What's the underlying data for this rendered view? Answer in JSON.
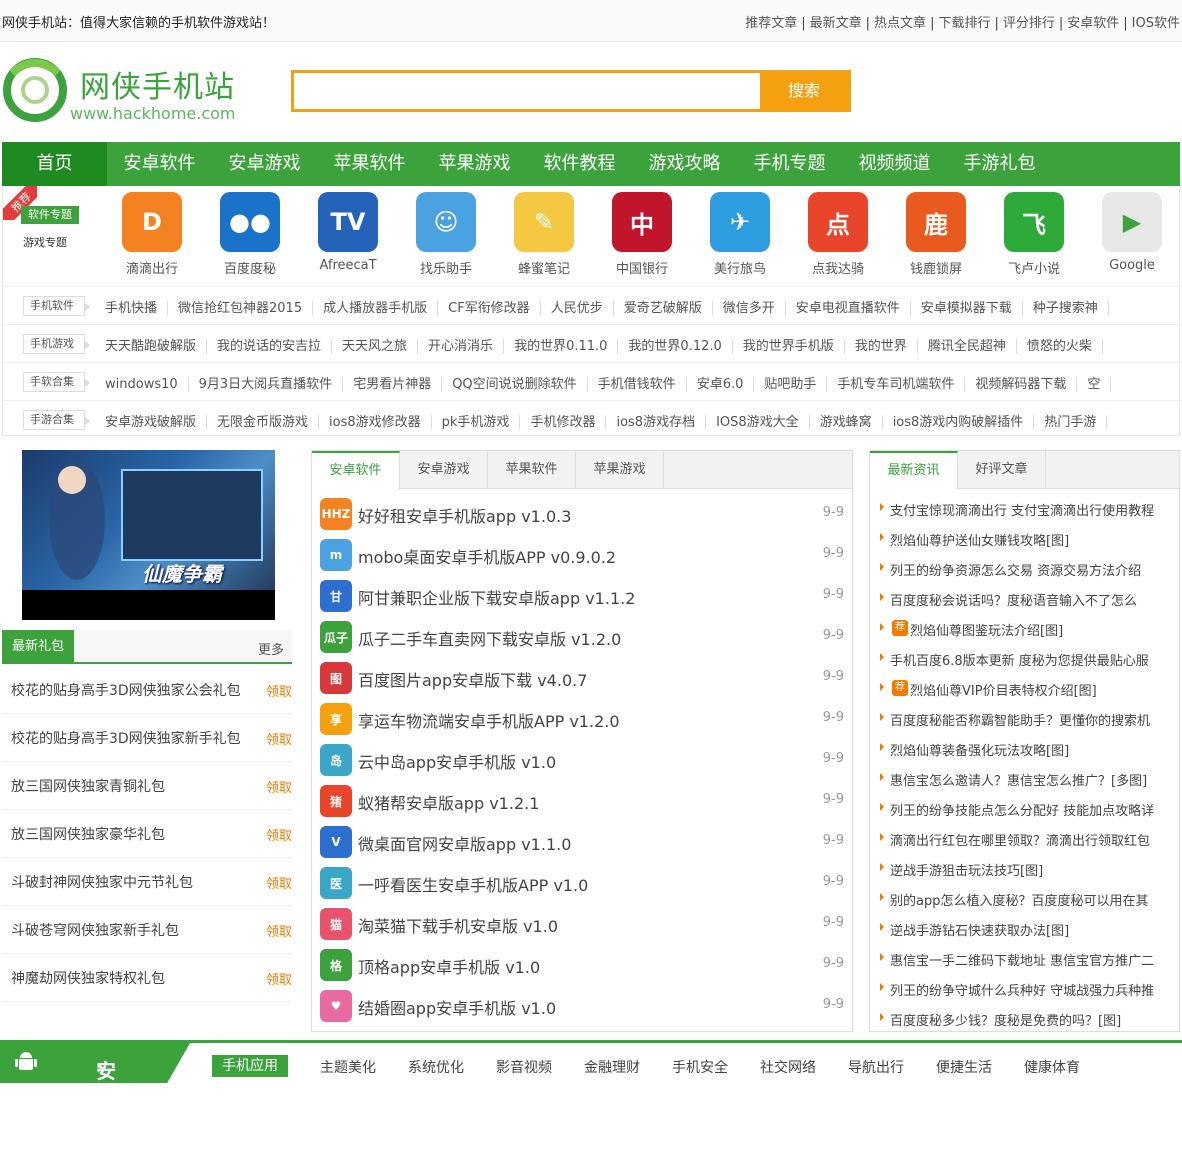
{
  "topbar": {
    "slogan": "网侠手机站：值得大家信赖的手机软件游戏站！",
    "links": [
      "推荐文章",
      "最新文章",
      "热点文章",
      "下载排行",
      "评分排行",
      "安卓软件",
      "IOS软件"
    ],
    "sep": "|"
  },
  "logo": {
    "name": "网侠手机站",
    "url": "www.hackhome.com"
  },
  "search": {
    "button": "搜索",
    "placeholder": ""
  },
  "nav": [
    "首页",
    "安卓软件",
    "安卓游戏",
    "苹果软件",
    "苹果游戏",
    "软件教程",
    "游戏攻略",
    "手机专题",
    "视频频道",
    "手游礼包"
  ],
  "featured": {
    "ribbon": "推荐",
    "special1": "软件专题",
    "special2": "游戏专题",
    "apps": [
      {
        "name": "滴滴出行",
        "color": "#f58220",
        "glyph": "D"
      },
      {
        "name": "百度度秘",
        "color": "#1a73c8",
        "glyph": "●●"
      },
      {
        "name": "AfreecaT",
        "color": "#2563b8",
        "glyph": "TV"
      },
      {
        "name": "找乐助手",
        "color": "#4aa3e0",
        "glyph": "☺"
      },
      {
        "name": "蜂蜜笔记",
        "color": "#f5c842",
        "glyph": "✎"
      },
      {
        "name": "中国银行",
        "color": "#c0152a",
        "glyph": "中"
      },
      {
        "name": "美行旅鸟",
        "color": "#2d9de0",
        "glyph": "✈"
      },
      {
        "name": "点我达骑",
        "color": "#e8452b",
        "glyph": "点"
      },
      {
        "name": "钱鹿锁屏",
        "color": "#e85a1e",
        "glyph": "鹿"
      },
      {
        "name": "飞卢小说",
        "color": "#2eaa3a",
        "glyph": "飞"
      },
      {
        "name": "Google",
        "color": "#e8e8e8",
        "glyph": "▶"
      }
    ]
  },
  "tagrows": [
    {
      "label": "手机软件",
      "tags": [
        "手机快播",
        "微信抢红包神器2015",
        "成人播放器手机版",
        "CF军衔修改器",
        "人民优步",
        "爱奇艺破解版",
        "微信多开",
        "安卓电视直播软件",
        "安卓模拟器下载",
        "种子搜索神"
      ]
    },
    {
      "label": "手机游戏",
      "tags": [
        "天天酷跑破解版",
        "我的说话的安吉拉",
        "天天风之旅",
        "开心消消乐",
        "我的世界0.11.0",
        "我的世界0.12.0",
        "我的世界手机版",
        "我的世界",
        "腾讯全民超神",
        "愤怒的火柴"
      ]
    },
    {
      "label": "手软合集",
      "tags": [
        "windows10",
        "9月3日大阅兵直播软件",
        "宅男看片神器",
        "QQ空间说说删除软件",
        "手机借钱软件",
        "安卓6.0",
        "贴吧助手",
        "手机专车司机端软件",
        "视频解码器下载",
        "空"
      ]
    },
    {
      "label": "手游合集",
      "tags": [
        "安卓游戏破解版",
        "无限金币版游戏",
        "ios8游戏修改器",
        "pk手机游戏",
        "手机修改器",
        "ios8游戏存档",
        "IOS8游戏大全",
        "游戏蜂窝",
        "ios8游戏内购破解插件",
        "热门手游"
      ]
    }
  ],
  "banner": {
    "caption": "仙魔争霸"
  },
  "gifts": {
    "title": "最新礼包",
    "more": "更多",
    "claim": "领取",
    "items": [
      "校花的贴身高手3D网侠独家公会礼包",
      "校花的贴身高手3D网侠独家新手礼包",
      "放三国网侠独家青铜礼包",
      "放三国网侠独家豪华礼包",
      "斗破封神网侠独家中元节礼包",
      "斗破苍穹网侠独家新手礼包",
      "神魔劫网侠独家特权礼包"
    ]
  },
  "mid": {
    "tabs": [
      "安卓软件",
      "安卓游戏",
      "苹果软件",
      "苹果游戏"
    ],
    "items": [
      {
        "name": "好好租安卓手机版app v1.0.3",
        "date": "9-9",
        "color": "#f58220",
        "glyph": "HHZ"
      },
      {
        "name": "mobo桌面安卓手机版APP v0.9.0.2",
        "date": "9-9",
        "color": "#4aa3e0",
        "glyph": "m"
      },
      {
        "name": "阿甘兼职企业版下载安卓版app v1.1.2",
        "date": "9-9",
        "color": "#2d6fcf",
        "glyph": "甘"
      },
      {
        "name": "瓜子二手车直卖网下载安卓版 v1.2.0",
        "date": "9-9",
        "color": "#3ca23c",
        "glyph": "瓜子"
      },
      {
        "name": "百度图片app安卓版下载 v4.0.7",
        "date": "9-9",
        "color": "#d9383a",
        "glyph": "图"
      },
      {
        "name": "享运车物流端安卓手机版APP v1.2.0",
        "date": "9-9",
        "color": "#f5a10f",
        "glyph": "享"
      },
      {
        "name": "云中岛app安卓手机版 v1.0",
        "date": "9-9",
        "color": "#3aa7c8",
        "glyph": "岛"
      },
      {
        "name": "蚁猪帮安卓版app v1.2.1",
        "date": "9-9",
        "color": "#e8452b",
        "glyph": "猪"
      },
      {
        "name": "微桌面官网安卓版app v1.1.0",
        "date": "9-9",
        "color": "#2d6fcf",
        "glyph": "V"
      },
      {
        "name": "一呼看医生安卓手机版APP v1.0",
        "date": "9-9",
        "color": "#3aa7c8",
        "glyph": "医"
      },
      {
        "name": "淘菜猫下载手机安卓版 v1.0",
        "date": "9-9",
        "color": "#e8526b",
        "glyph": "猫"
      },
      {
        "name": "顶格app安卓手机版 v1.0",
        "date": "9-9",
        "color": "#3ca23c",
        "glyph": "格"
      },
      {
        "name": "结婚圈app安卓手机版 v1.0",
        "date": "9-9",
        "color": "#e86aa0",
        "glyph": "♥"
      }
    ]
  },
  "right": {
    "tabs": [
      "最新资讯",
      "好评文章"
    ],
    "badge": "荐",
    "items": [
      {
        "text": "支付宝惊现滴滴出行 支付宝滴滴出行使用教程",
        "badge": false
      },
      {
        "text": "烈焰仙尊护送仙女赚钱攻略[图]",
        "badge": false
      },
      {
        "text": "列王的纷争资源怎么交易 资源交易方法介绍",
        "badge": false
      },
      {
        "text": "百度度秘会说话吗？度秘语音输入不了怎么",
        "badge": false
      },
      {
        "text": "烈焰仙尊图鉴玩法介绍[图]",
        "badge": true
      },
      {
        "text": "手机百度6.8版本更新 度秘为您提供最贴心服",
        "badge": false
      },
      {
        "text": "烈焰仙尊VIP价目表特权介绍[图]",
        "badge": true
      },
      {
        "text": "百度度秘能否称霸智能助手？更懂你的搜索机",
        "badge": false
      },
      {
        "text": "烈焰仙尊装备强化玩法攻略[图]",
        "badge": false
      },
      {
        "text": "惠信宝怎么邀请人？惠信宝怎么推广？[多图]",
        "badge": false
      },
      {
        "text": "列王的纷争技能点怎么分配好 技能加点攻略详",
        "badge": false
      },
      {
        "text": "滴滴出行红包在哪里领取？滴滴出行领取红包",
        "badge": false
      },
      {
        "text": "逆战手游狙击玩法技巧[图]",
        "badge": false
      },
      {
        "text": "别的app怎么植入度秘？百度度秘可以用在其",
        "badge": false
      },
      {
        "text": "逆战手游钻石快速获取办法[图]",
        "badge": false
      },
      {
        "text": "惠信宝一手二维码下载地址 惠信宝官方推广二",
        "badge": false
      },
      {
        "text": "列王的纷争守城什么兵种好 守城战强力兵种推",
        "badge": false
      },
      {
        "text": "百度度秘多少钱？度秘是免费的吗？[图]",
        "badge": false
      }
    ]
  },
  "bottom": {
    "section": "安卓软件",
    "arrow": "›",
    "tabs": [
      "手机应用",
      "主题美化",
      "系统优化",
      "影音视频",
      "金融理财",
      "手机安全",
      "社交网络",
      "导航出行",
      "便捷生活",
      "健康体育"
    ]
  }
}
